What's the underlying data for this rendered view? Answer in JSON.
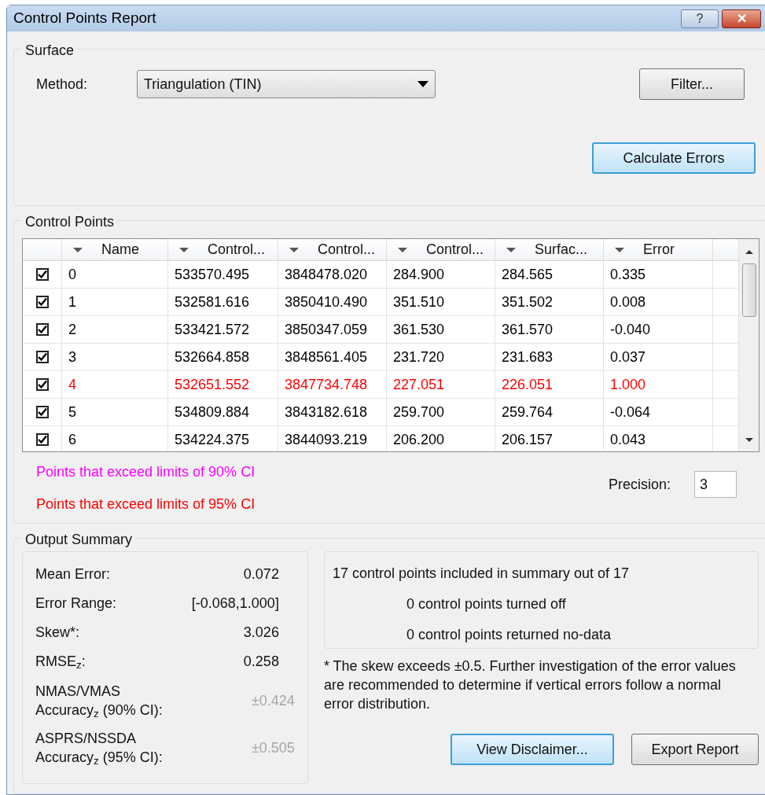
{
  "window": {
    "title": "Control Points Report",
    "buttons": [
      "?",
      "✕"
    ]
  },
  "surface": {
    "title": "Surface",
    "method_label": "Method:",
    "method_value": "Triangulation (TIN)",
    "filter_button": "Filter...",
    "calculate_button": "Calculate Errors"
  },
  "control_points": {
    "title": "Control Points",
    "table": {
      "columns": [
        "Name",
        "Control...",
        "Control...",
        "Control...",
        "Surfac...",
        "Error"
      ],
      "rows": [
        {
          "checked": true,
          "color": "#000000",
          "cells": [
            "0",
            "533570.495",
            "3848478.020",
            "284.900",
            "284.565",
            "0.335"
          ]
        },
        {
          "checked": true,
          "color": "#000000",
          "cells": [
            "1",
            "532581.616",
            "3850410.490",
            "351.510",
            "351.502",
            "0.008"
          ]
        },
        {
          "checked": true,
          "color": "#000000",
          "cells": [
            "2",
            "533421.572",
            "3850347.059",
            "361.530",
            "361.570",
            "-0.040"
          ]
        },
        {
          "checked": true,
          "color": "#000000",
          "cells": [
            "3",
            "532664.858",
            "3848561.405",
            "231.720",
            "231.683",
            "0.037"
          ]
        },
        {
          "checked": true,
          "color": "#ff0000",
          "cells": [
            "4",
            "532651.552",
            "3847734.748",
            "227.051",
            "226.051",
            "1.000"
          ]
        },
        {
          "checked": true,
          "color": "#000000",
          "cells": [
            "5",
            "534809.884",
            "3843182.618",
            "259.700",
            "259.764",
            "-0.064"
          ]
        },
        {
          "checked": true,
          "color": "#000000",
          "cells": [
            "6",
            "534224.375",
            "3844093.219",
            "206.200",
            "206.157",
            "0.043"
          ]
        }
      ]
    },
    "legend": [
      {
        "text": "Points that exceed limits of 90% CI",
        "color": "#ff00ff"
      },
      {
        "text": "Points that exceed limits of 95% CI",
        "color": "#ff0000"
      }
    ],
    "precision_label": "Precision:",
    "precision_value": "3"
  },
  "output_summary": {
    "title": "Output Summary",
    "stats": [
      {
        "label": "Mean Error:",
        "value": "0.072",
        "disabled": false
      },
      {
        "label": "Error Range:",
        "value": "[-0.068,1.000]",
        "disabled": false
      },
      {
        "label": "Skew*:",
        "value": "3.026",
        "disabled": false
      },
      {
        "label": "RMSE$_{z}$:",
        "value": "0.258",
        "disabled": false
      },
      {
        "label": "NMAS/VMAS Accuracy$_{z}$ (90% CI):",
        "value": "±0.424",
        "disabled": true
      },
      {
        "label": "ASPRS/NSSDA Accuracy$_{z}$ (95% CI):",
        "value": "±0.505",
        "disabled": true
      }
    ],
    "info_lines": [
      "17 control points included in summary out of 17",
      "0 control points turned off",
      "0 control points returned no-data"
    ],
    "note": "* The skew exceeds ±0.5. Further investigation of the error values are recommended to determine if vertical errors follow a normal error distribution.",
    "buttons": [
      "View Disclaimer...",
      "Export Report"
    ]
  }
}
